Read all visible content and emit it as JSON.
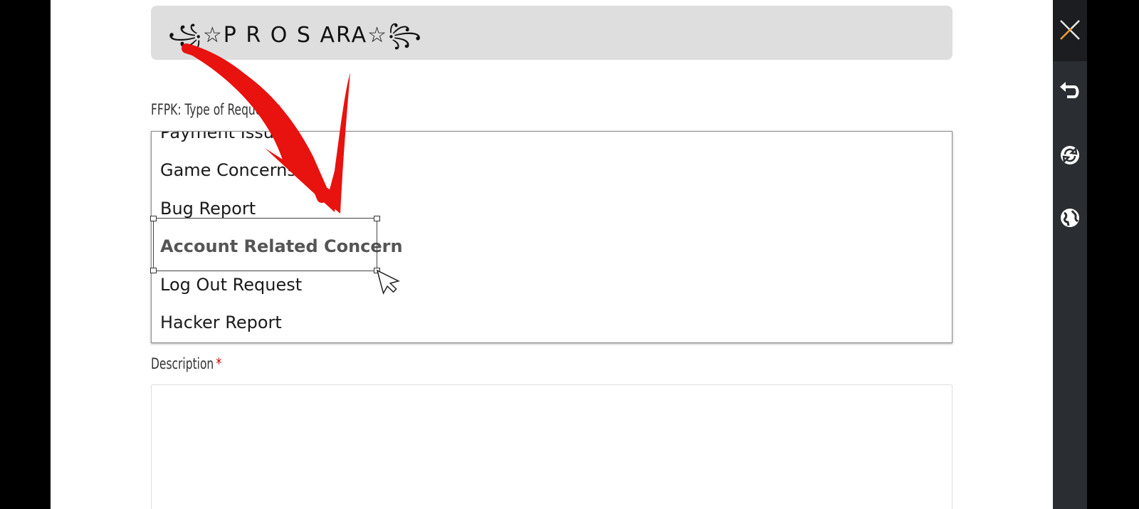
{
  "banner": {
    "title": "꧁☆P R O S ARA☆꧂"
  },
  "form": {
    "request_type_label": "FFPK: Type of Request",
    "description_label": "Description",
    "required_marker": "*",
    "options": [
      "Payment Issue",
      "Game Concerns",
      "Bug Report",
      "Account Related Concern",
      "Log Out Request",
      "Hacker Report"
    ],
    "selected_option": "Account Related Concern",
    "description_value": ""
  },
  "toolbar": {
    "icons": [
      "close-icon",
      "undo-icon",
      "sync-icon",
      "globe-icon"
    ]
  },
  "colors": {
    "arrow": "#e8120f",
    "required": "#cc0000",
    "sidebar_bg": "#2a2d31"
  }
}
